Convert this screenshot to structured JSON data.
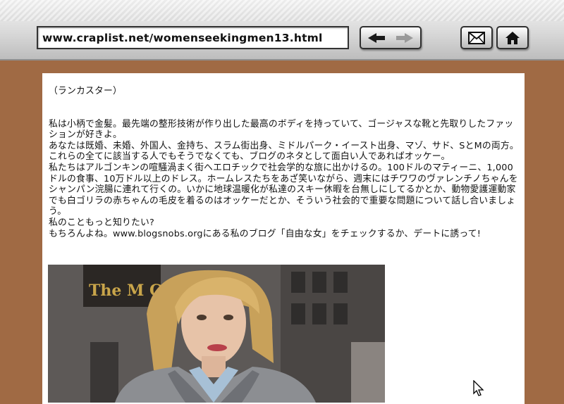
{
  "browser": {
    "url": "www.craplist.net/womenseekingmen13.html",
    "icons": {
      "back": "back-arrow-icon",
      "forward": "forward-arrow-icon",
      "mail": "envelope-icon",
      "home": "home-icon"
    }
  },
  "post": {
    "location": "（ランカスター）",
    "paragraphs": [
      "私は小柄で金髪。最先端の整形技術が作り出した最高のボディを持っていて、ゴージャスな靴と先取りしたファッションが好きよ。",
      "あなたは既婚、未婚、外国人、金持ち、スラム街出身、ミドルパーク・イースト出身、マゾ、サド、SとMの両方。これらの全てに該当する人でもそうでなくても、ブログのネタとして面白い人であればオッケー。",
      "私たちはアルゴンキンの喧騒渦まく街へエロチックで社会学的な旅に出かけるの。100ドルのマティーニ、1,000ドルの食事、10万ドル以上のドレス。ホームレスたちをあざ笑いながら、週末にはチワワのヴァレンチノちゃんをシャンパン浣腸に連れて行くの。いかに地球温暖化が私達のスキー休暇を台無しにしてるかとか、動物愛護運動家でも白ゴリラの赤ちゃんの毛皮を着るのはオッケーだとか、そういう社会的で重要な問題について話し合いましょう。",
      "私のこともっと知りたい?",
      "もちろんよね。www.blogsnobs.orgにある私のブログ「自由な女」をチェックするか、デートに誘って!"
    ],
    "photo_sign_text": "The M CUR"
  },
  "colors": {
    "page_background": "#a06a44",
    "content_background": "#ffffff",
    "text": "#111111"
  }
}
